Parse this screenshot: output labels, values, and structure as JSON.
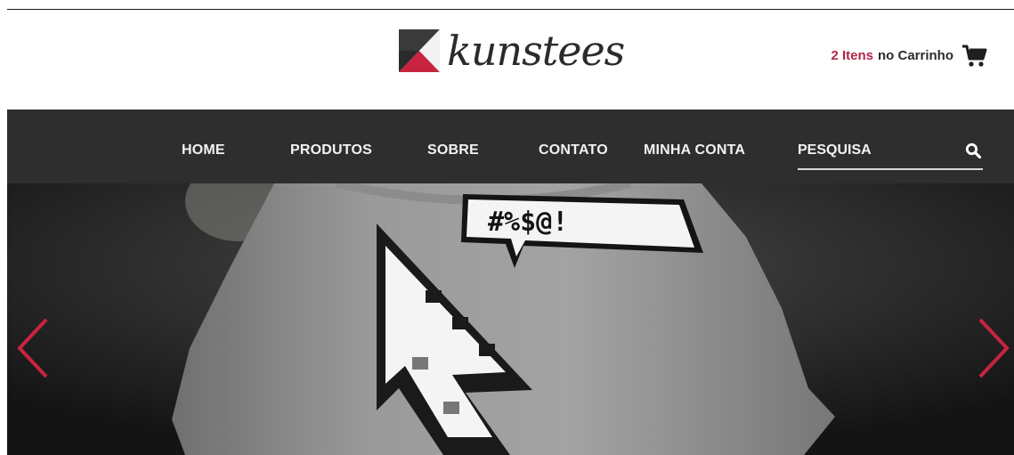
{
  "brand": {
    "name": "kunstees",
    "colors": {
      "accent": "#b0264a",
      "mark_dark": "#3a3a3a",
      "nav_bg": "#2e2e2e"
    }
  },
  "cart": {
    "count_label": "2 Itens",
    "suffix_label": "no Carrinho",
    "icon": "cart-icon"
  },
  "nav": {
    "items": [
      {
        "label": "HOME"
      },
      {
        "label": "PRODUTOS"
      },
      {
        "label": "SOBRE"
      },
      {
        "label": "CONTATO"
      },
      {
        "label": "MINHA CONTA"
      }
    ],
    "search": {
      "label": "PESQUISA",
      "icon": "search-icon"
    }
  },
  "hero": {
    "prev_icon": "chevron-left-icon",
    "next_icon": "chevron-right-icon",
    "arrow_color": "#c8243f",
    "speech_bubble_text": "#%$@!"
  }
}
